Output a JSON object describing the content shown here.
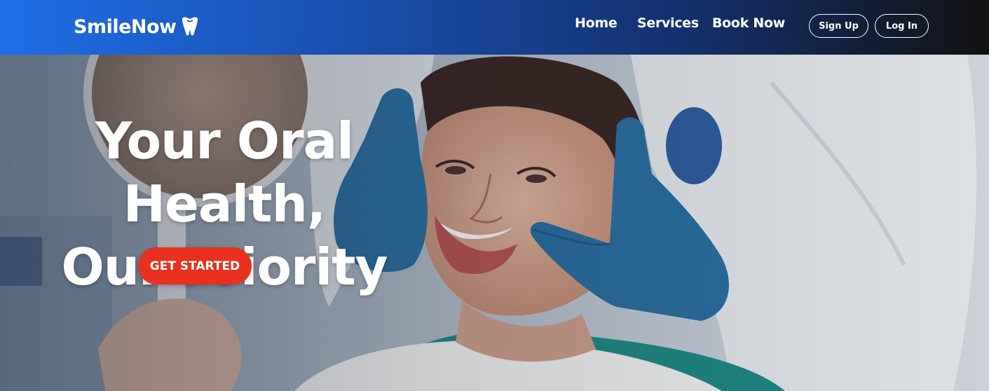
{
  "header": {
    "brand": "SmileNow",
    "brand_icon": "tooth-icon",
    "nav": {
      "home": "Home",
      "services": "Services",
      "book_now": "Book Now"
    },
    "sign_up": "Sign Up",
    "log_in": "Log In"
  },
  "hero": {
    "title_line1": "Your Oral Health,",
    "title_line2": "Our Priority",
    "cta_label": "GET STARTED",
    "image": "patient-smiling-dental-exam-photo"
  },
  "colors": {
    "nav_gradient_start": "#1f6fe6",
    "nav_gradient_end": "#121212",
    "cta": "#e8321f",
    "text": "#ffffff"
  }
}
